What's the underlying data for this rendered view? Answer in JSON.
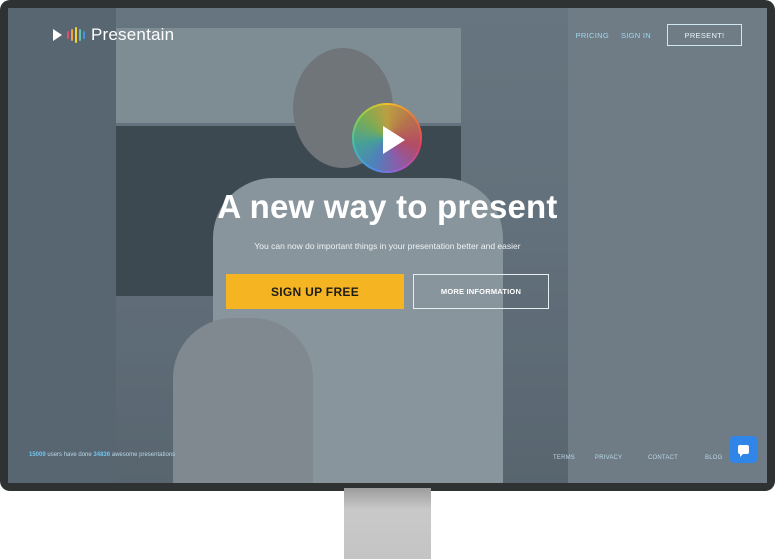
{
  "brand": {
    "name": "Presentain",
    "bar_colors": [
      "#e64a6b",
      "#f0a43a",
      "#f2d13b",
      "#5ec3b2",
      "#4b8fe6"
    ]
  },
  "nav": {
    "pricing": "PRICING",
    "signin": "SIGN IN",
    "present": "PRESENT!"
  },
  "hero": {
    "headline": "A new way to present",
    "subline": "You can now do important things in your presentation better and easier",
    "signup": "SIGN UP FREE",
    "more": "MORE INFORMATION"
  },
  "stats": {
    "users": "15009",
    "text1": "users have done",
    "presentations": "34836",
    "text2": "awesome presentations"
  },
  "footer": {
    "terms": "TERMS",
    "privacy": "PRIVACY",
    "contact": "CONTACT",
    "blog": "BLOG"
  },
  "colors": {
    "accent_yellow": "#f5b522",
    "nav_blue": "#9fd8f0",
    "chat_blue": "#2f86e8"
  }
}
